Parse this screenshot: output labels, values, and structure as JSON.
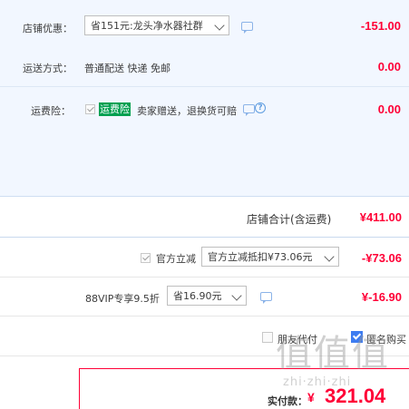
{
  "store_discount": {
    "label": "店铺优惠：",
    "select_value": "省151元:龙头净水器社群",
    "amount": "-151.00"
  },
  "shipping": {
    "label": "运送方式：",
    "value": "普通配送 快递 免邮",
    "amount": "0.00"
  },
  "freight_insurance": {
    "label": "运费险：",
    "badge": "运费险",
    "description": "卖家赠送，退换货可赔",
    "amount": "0.00"
  },
  "store_total": {
    "label": "店铺合计(含运费)",
    "amount": "¥411.00"
  },
  "official_discount": {
    "label": "官方立减",
    "select_value": "官方立减抵扣¥73.06元",
    "amount": "-¥73.06"
  },
  "vip_discount": {
    "label": "88VIP专享9.5折",
    "select_value": "省16.90元",
    "amount": "¥-16.90"
  },
  "options": {
    "friend_pay_label": "朋友代付",
    "anonymous_label": "匿名购买"
  },
  "payment": {
    "label": "实付款：",
    "currency": "¥",
    "amount": "321.04"
  },
  "watermark": {
    "glyphs": "值值值",
    "site": "zhi·zhi·zhi"
  },
  "colors": {
    "price_red": "#ff0036",
    "panel_bg": "#f2f7ff",
    "badge_green": "#00a050",
    "check_blue": "#3d7cf1"
  }
}
